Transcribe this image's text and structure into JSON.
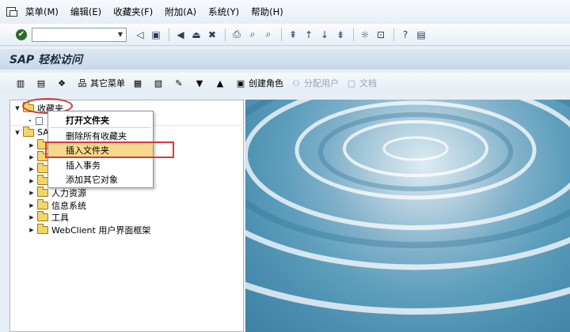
{
  "menubar": {
    "items": [
      "菜单(M)",
      "编辑(E)",
      "收藏夹(F)",
      "附加(A)",
      "系统(Y)",
      "帮助(H)"
    ]
  },
  "toolbar": {
    "command_value": ""
  },
  "title": "SAP 轻松访问",
  "app_toolbar": {
    "other_menu": "其它菜单",
    "create_role": "创建角色",
    "assign_user": "分配用户",
    "documentation": "文档"
  },
  "tree": {
    "favorites": "收藏夹",
    "sap_menu": "SAP",
    "nodes": [
      "人力资源",
      "信息系统",
      "工具",
      "WebClient 用户界面框架"
    ]
  },
  "context_menu": {
    "items": [
      "打开文件夹",
      "删除所有收藏夹",
      "插入文件夹",
      "插入事务",
      "添加其它对象"
    ]
  },
  "colors": {
    "highlight": "#f6d98c",
    "annotation": "#d93838"
  }
}
